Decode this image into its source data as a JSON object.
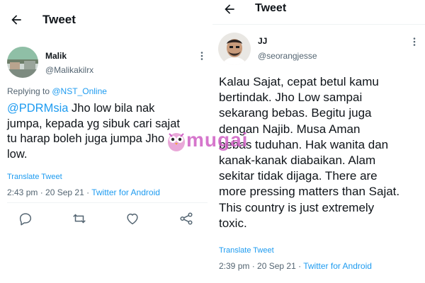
{
  "left_tweet": {
    "header_title": "Tweet",
    "author_name": "Malik",
    "author_handle": "@Malikakilrx",
    "replying_prefix": "Replying to ",
    "replying_to": "@NST_Online",
    "mention": "@PDRMsia",
    "body_line1_rest": " Jho low bila nak",
    "body_line2": "jumpa,  kepada yg sibuk cari sajat",
    "body_line3": "tu harap boleh juga jumpa Jho",
    "body_line4": "low.",
    "translate_label": "Translate Tweet",
    "time": "2:43 pm",
    "date": "20 Sep 21",
    "source": "Twitter for Android",
    "meta_separator": " · "
  },
  "right_tweet": {
    "header_title": "Tweet",
    "author_name": "JJ",
    "author_handle": "@seorangjesse",
    "body_lines": [
      "Kalau Sajat, cepat betul kamu",
      "bertindak. Jho Low sampai",
      "sekarang bebas. Begitu juga",
      "dengan Najib. Musa Aman",
      "bebas tuduhan. Hak wanita dan",
      "kanak-kanak diabaikan. Alam",
      "sekitar tidak dijaga. There are",
      "more pressing matters than Sajat.",
      "This country is just extremely",
      "toxic."
    ],
    "translate_label": "Translate Tweet",
    "time": "2:39 pm",
    "date": "20 Sep 21",
    "source": "Twitter for Android",
    "meta_separator": " · "
  },
  "watermark": {
    "text": "mugai",
    "icon": "owl-mascot-icon"
  },
  "icons": {
    "back": "arrow-left-icon",
    "more": "more-vertical-icon",
    "reply": "reply-icon",
    "retweet": "retweet-icon",
    "like": "heart-icon",
    "share": "share-icon"
  },
  "colors": {
    "link": "#1d9bf0",
    "secondary_text": "#536471",
    "primary_text": "#0f1419",
    "watermark": "#cf5fc4"
  }
}
